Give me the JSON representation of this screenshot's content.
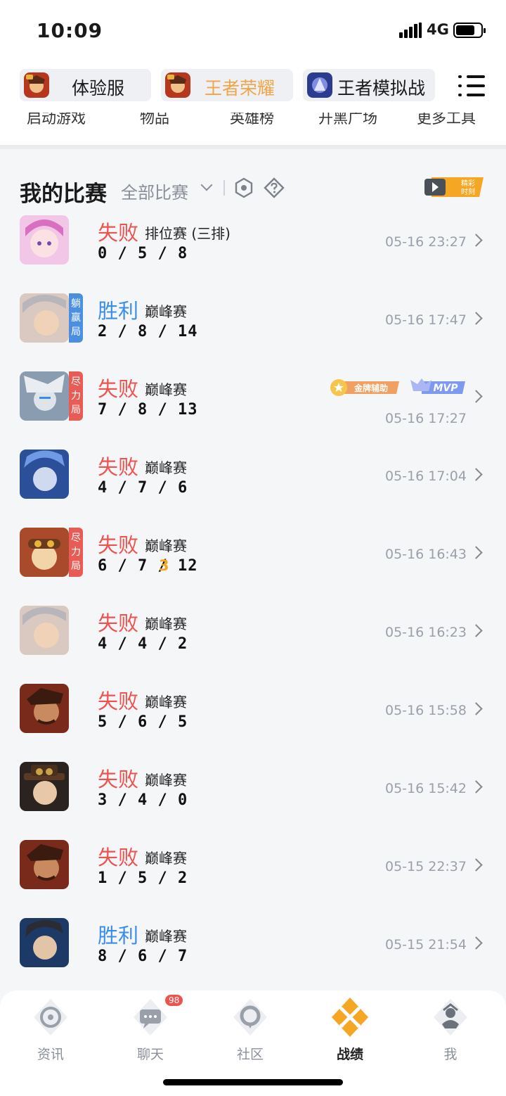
{
  "status_bar": {
    "time": "10:09",
    "network": "4G"
  },
  "game_tabs": [
    {
      "label": "体验服",
      "icon": "game-icon-1"
    },
    {
      "label": "王者荣耀",
      "icon": "game-icon-2",
      "active": true
    },
    {
      "label": "王者模拟战",
      "icon": "game-icon-3"
    }
  ],
  "tools": [
    "启动游戏",
    "物品",
    "英雄榜",
    "开黑广场",
    "更多工具"
  ],
  "section": {
    "title": "我的比赛",
    "filter": "全部比赛",
    "badge_text": "精彩时刻"
  },
  "matches": [
    {
      "result": "失败",
      "outcome": "lose",
      "mode": "排位赛 (三排)",
      "kda": "0/5/8",
      "time": "05-16 23:27"
    },
    {
      "result": "胜利",
      "outcome": "win",
      "mode": "巅峰赛",
      "kda": "2/8/14",
      "time": "05-16 17:47",
      "tag": "躺赢局"
    },
    {
      "result": "失败",
      "outcome": "lose",
      "mode": "巅峰赛",
      "kda": "7/8/13",
      "time": "05-16 17:27",
      "tag": "尽力局",
      "badges": [
        "金牌辅助",
        "MVP"
      ]
    },
    {
      "result": "失败",
      "outcome": "lose",
      "mode": "巅峰赛",
      "kda": "4/7/6",
      "time": "05-16 17:04"
    },
    {
      "result": "失败",
      "outcome": "lose",
      "mode": "巅峰赛",
      "kda": "6/7/12",
      "time": "05-16 16:43",
      "tag": "尽力局",
      "extra": "3"
    },
    {
      "result": "失败",
      "outcome": "lose",
      "mode": "巅峰赛",
      "kda": "4/4/2",
      "time": "05-16 16:23"
    },
    {
      "result": "失败",
      "outcome": "lose",
      "mode": "巅峰赛",
      "kda": "5/6/5",
      "time": "05-16 15:58"
    },
    {
      "result": "失败",
      "outcome": "lose",
      "mode": "巅峰赛",
      "kda": "3/4/0",
      "time": "05-16 15:42"
    },
    {
      "result": "失败",
      "outcome": "lose",
      "mode": "巅峰赛",
      "kda": "1/5/2",
      "time": "05-15 22:37"
    },
    {
      "result": "胜利",
      "outcome": "win",
      "mode": "巅峰赛",
      "kda": "8/6/7",
      "time": "05-15 21:54"
    }
  ],
  "tabbar": [
    {
      "label": "资讯",
      "icon": "news-icon"
    },
    {
      "label": "聊天",
      "icon": "chat-icon",
      "badge": "98"
    },
    {
      "label": "社区",
      "icon": "community-icon"
    },
    {
      "label": "战绩",
      "icon": "record-icon",
      "active": true
    },
    {
      "label": "我",
      "icon": "profile-icon"
    }
  ],
  "colors": {
    "lose": "#ef5350",
    "win": "#3a8ee8",
    "accent": "#f5a623"
  }
}
